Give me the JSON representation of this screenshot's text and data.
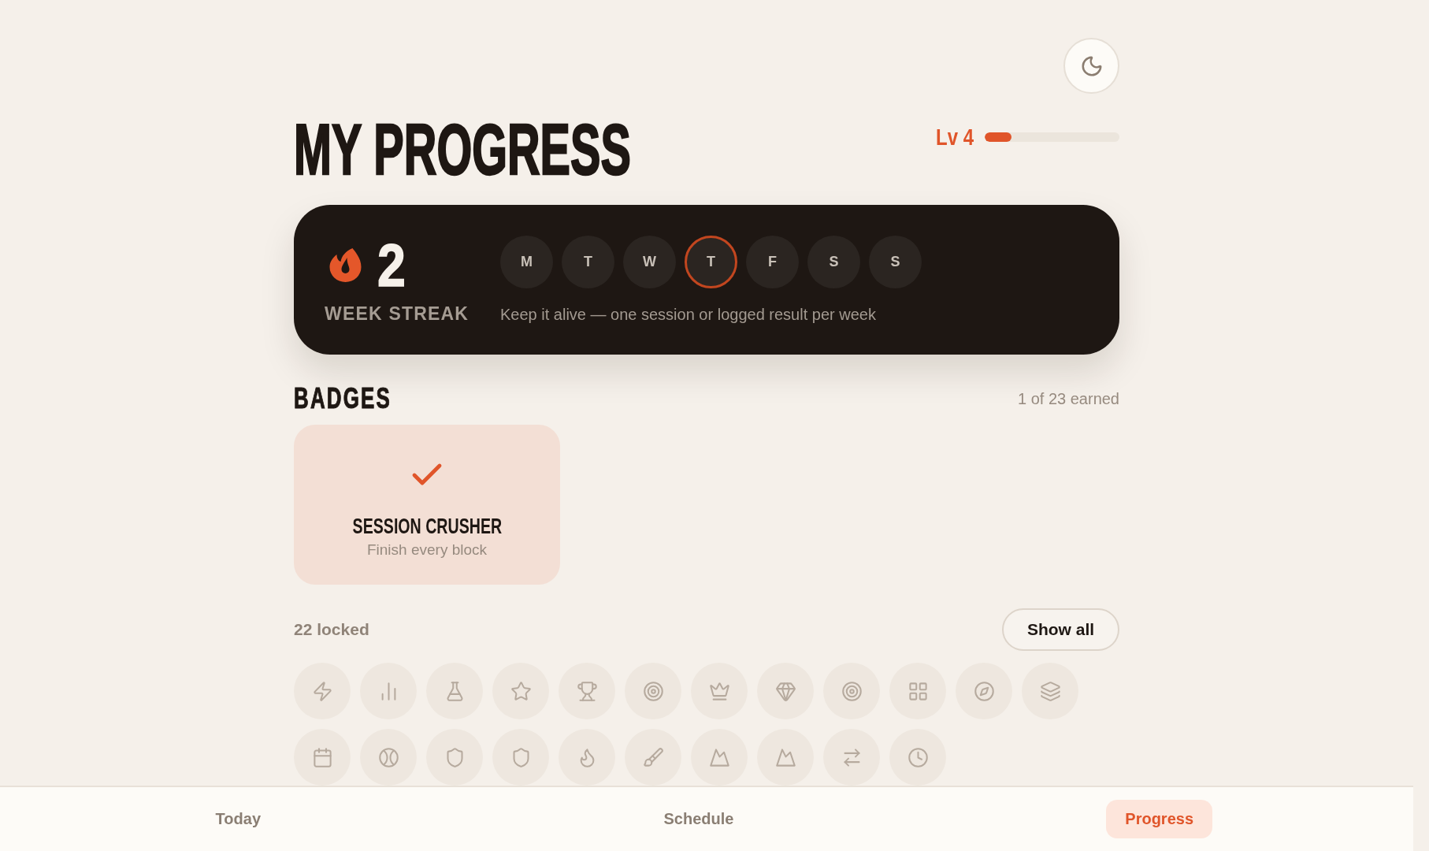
{
  "header": {
    "title": "MY PROGRESS",
    "level": {
      "label": "Lv 4",
      "level": 0.2
    }
  },
  "streak": {
    "count": "2",
    "label": "WEEK STREAK",
    "days": [
      {
        "label": "M",
        "current": false
      },
      {
        "label": "T",
        "current": false
      },
      {
        "label": "W",
        "current": false
      },
      {
        "label": "T",
        "current": true
      },
      {
        "label": "F",
        "current": false
      },
      {
        "label": "S",
        "current": false
      },
      {
        "label": "S",
        "current": false
      }
    ],
    "hint": "Keep it alive — one session or logged result per week"
  },
  "badges": {
    "title": "BADGES",
    "earned_count": "1 of 23 earned",
    "earned": [
      {
        "title": "SESSION CRUSHER",
        "description": "Finish every block"
      }
    ],
    "locked_count": "22 locked",
    "show_all_button": "Show all",
    "locked": [
      {
        "kind": "bolt"
      },
      {
        "kind": "bars"
      },
      {
        "kind": "flask"
      },
      {
        "kind": "star"
      },
      {
        "kind": "trophy"
      },
      {
        "kind": "target"
      },
      {
        "kind": "crown"
      },
      {
        "kind": "gem"
      },
      {
        "kind": "target"
      },
      {
        "kind": "grid"
      },
      {
        "kind": "compass"
      },
      {
        "kind": "layers"
      },
      {
        "kind": "calendar"
      },
      {
        "kind": "ball"
      },
      {
        "kind": "shield"
      },
      {
        "kind": "shield"
      },
      {
        "kind": "flame"
      },
      {
        "kind": "brush"
      },
      {
        "kind": "mountain"
      },
      {
        "kind": "mountain"
      },
      {
        "kind": "arrows"
      },
      {
        "kind": "clock"
      }
    ]
  },
  "bottom_nav": [
    {
      "label": "Today",
      "selected": false
    },
    {
      "label": "Schedule",
      "selected": false
    },
    {
      "label": "Progress",
      "selected": true
    }
  ]
}
